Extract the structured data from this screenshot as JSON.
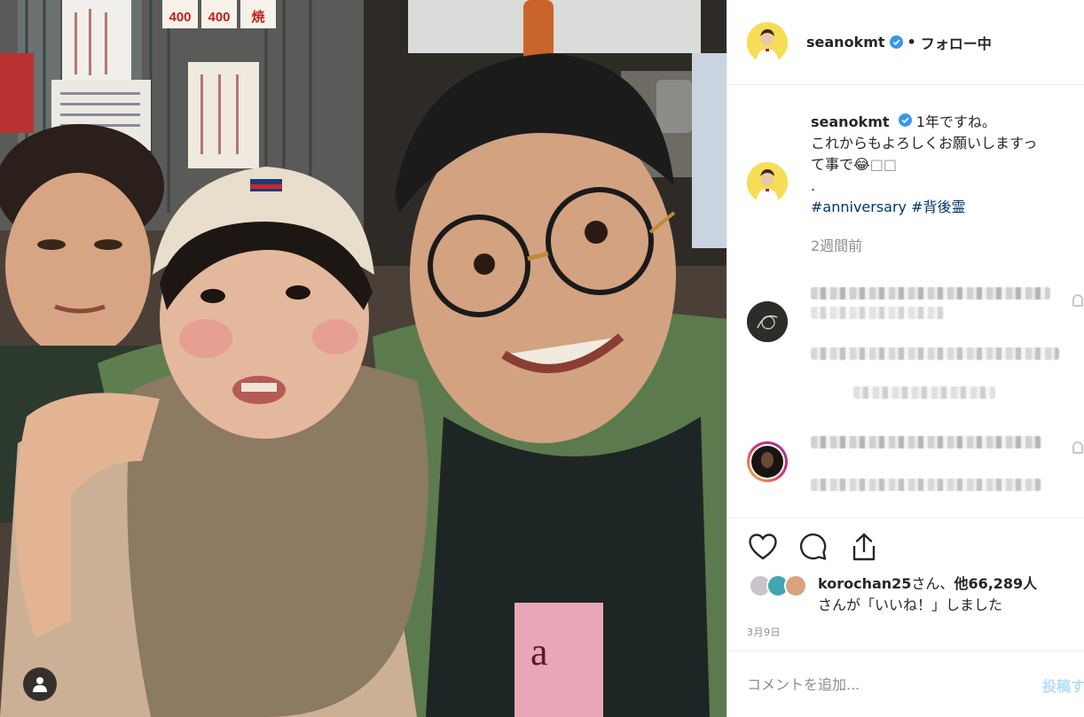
{
  "post": {
    "username": "seanokmt",
    "follow_state": "フォロー中",
    "separator": "•",
    "verified": true
  },
  "photo": {
    "signs": [
      "400",
      "400",
      "焼"
    ],
    "shirt_print": "a",
    "tag_icon": "user-tag-icon"
  },
  "caption": {
    "username": "seanokmt",
    "line1": "1年ですね。",
    "line2": "これからもよろしくお願いしますっ",
    "line3": "て事で😂",
    "line3_tail": "□□",
    "dot_line": ".",
    "hashtag1": "#anniversary",
    "hashtag2": "#背後霊",
    "time_ago": "2週間前"
  },
  "likes": {
    "user": "korochan25",
    "suffix": "さん、",
    "others": "他66,289人",
    "line2": "さんが「いいね！」しました"
  },
  "date": "3月9日",
  "comment": {
    "placeholder": "コメントを追加...",
    "post_label": "投稿する"
  },
  "icons": {
    "like": "heart-icon",
    "comment": "comment-bubble-icon",
    "share": "share-icon",
    "verified": "verified-badge-icon"
  },
  "colors": {
    "text": "#262626",
    "secondary": "#8e8e8e",
    "hashtag": "#00376b",
    "verified": "#3897f0",
    "post_button_disabled": "#b2dffc",
    "avatar_bg": "#f6dd55"
  }
}
